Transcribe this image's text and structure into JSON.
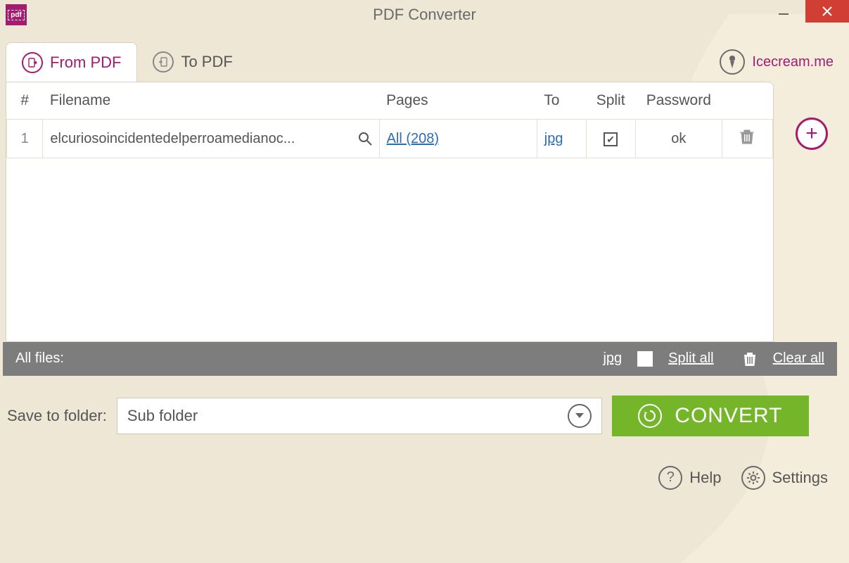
{
  "window": {
    "title": "PDF Converter"
  },
  "tabs": {
    "from_pdf": "From PDF",
    "to_pdf": "To PDF",
    "active": "from_pdf"
  },
  "brand": {
    "label": "Icecream.me"
  },
  "columns": {
    "num": "#",
    "filename": "Filename",
    "pages": "Pages",
    "to": "To",
    "split": "Split",
    "password": "Password"
  },
  "rows": [
    {
      "num": "1",
      "filename": "elcuriosoincidentedelperroamedianoc...",
      "pages": "All (208)",
      "to": "jpg",
      "split_checked": true,
      "password": "ok"
    }
  ],
  "footer": {
    "all_files": "All files:",
    "to": "jpg",
    "split_all": "Split all",
    "clear_all": "Clear all"
  },
  "save": {
    "label": "Save to folder:",
    "value": "Sub folder"
  },
  "convert": {
    "label": "CONVERT"
  },
  "links": {
    "help": "Help",
    "settings": "Settings"
  }
}
